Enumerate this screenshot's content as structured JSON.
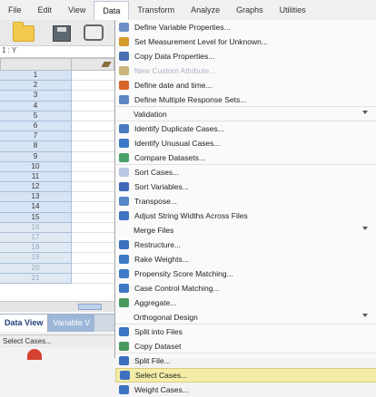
{
  "menubar": {
    "items": [
      {
        "label": "File",
        "active": false
      },
      {
        "label": "Edit",
        "active": false
      },
      {
        "label": "View",
        "active": false
      },
      {
        "label": "Data",
        "active": true
      },
      {
        "label": "Transform",
        "active": false
      },
      {
        "label": "Analyze",
        "active": false
      },
      {
        "label": "Graphs",
        "active": false
      },
      {
        "label": "Utilities",
        "active": false
      }
    ]
  },
  "cellref": "1 : Y",
  "grid": {
    "rows": [
      "1",
      "2",
      "3",
      "4",
      "5",
      "6",
      "7",
      "8",
      "9",
      "10",
      "11",
      "12",
      "13",
      "14",
      "15",
      "16",
      "17",
      "18",
      "19",
      "20",
      "21"
    ],
    "dim_rows_from": 16
  },
  "tabs": {
    "data_view": "Data View",
    "variable_view": "Variable V"
  },
  "status": "Select Cases...",
  "data_menu": {
    "items": [
      {
        "label": "Define Variable Properties...",
        "icon": "define-variable-properties-icon",
        "color": "#6b8fc7"
      },
      {
        "label": "Set Measurement Level for Unknown...",
        "icon": "measurement-level-icon",
        "color": "#d49a2a"
      },
      {
        "label": "Copy Data Properties...",
        "icon": "copy-data-properties-icon",
        "color": "#4b6fb5"
      },
      {
        "label": "New Custom Attribute...",
        "icon": "custom-attribute-icon",
        "color": "#c9b47a",
        "dim": true
      },
      {
        "label": "Define date and time...",
        "icon": "date-time-icon",
        "color": "#d9642a"
      },
      {
        "label": "Define Multiple Response Sets...",
        "icon": "multiple-response-icon",
        "color": "#5f86c4",
        "sep": true
      },
      {
        "label": "Validation",
        "submenu": true,
        "indent": true,
        "sep": true
      },
      {
        "label": "Identify Duplicate Cases...",
        "icon": "duplicate-cases-icon",
        "color": "#4a79c0"
      },
      {
        "label": "Identify Unusual Cases...",
        "icon": "unusual-cases-icon",
        "color": "#3b79c6"
      },
      {
        "label": "Compare Datasets...",
        "icon": "compare-datasets-icon",
        "color": "#4ca16a",
        "sep": true
      },
      {
        "label": "Sort Cases...",
        "icon": "sort-cases-icon",
        "color": "#b9c6e2"
      },
      {
        "label": "Sort Variables...",
        "icon": "sort-variables-icon",
        "color": "#3f68b8"
      },
      {
        "label": "Transpose...",
        "icon": "transpose-icon",
        "color": "#5586c7"
      },
      {
        "label": "Adjust String Widths Across Files",
        "icon": "adjust-string-widths-icon",
        "color": "#3d73c2"
      },
      {
        "label": "Merge Files",
        "submenu": true,
        "indent": true
      },
      {
        "label": "Restructure...",
        "icon": "restructure-icon",
        "color": "#3b6fc0"
      },
      {
        "label": "Rake Weights...",
        "icon": "rake-weights-icon",
        "color": "#3d79c5"
      },
      {
        "label": "Propensity Score Matching...",
        "icon": "propensity-score-icon",
        "color": "#3d7ac7"
      },
      {
        "label": "Case Control Matching...",
        "icon": "case-control-icon",
        "color": "#3c78c6"
      },
      {
        "label": "Aggregate...",
        "icon": "aggregate-icon",
        "color": "#4a9a5e"
      },
      {
        "label": "Orthogonal Design",
        "submenu": true,
        "indent": true,
        "sep": true
      },
      {
        "label": "Split into Files",
        "icon": "split-into-files-icon",
        "color": "#3b75c3"
      },
      {
        "label": "Copy Dataset",
        "icon": "copy-dataset-icon",
        "color": "#4a9a5e",
        "sep": true
      },
      {
        "label": "Split File...",
        "icon": "split-file-icon",
        "color": "#3d6fbe"
      },
      {
        "label": "Select Cases...",
        "icon": "select-cases-icon",
        "color": "#3d6fbe",
        "highlight": true
      },
      {
        "label": "Weight Cases...",
        "icon": "weight-cases-icon",
        "color": "#3d74c2"
      }
    ]
  }
}
